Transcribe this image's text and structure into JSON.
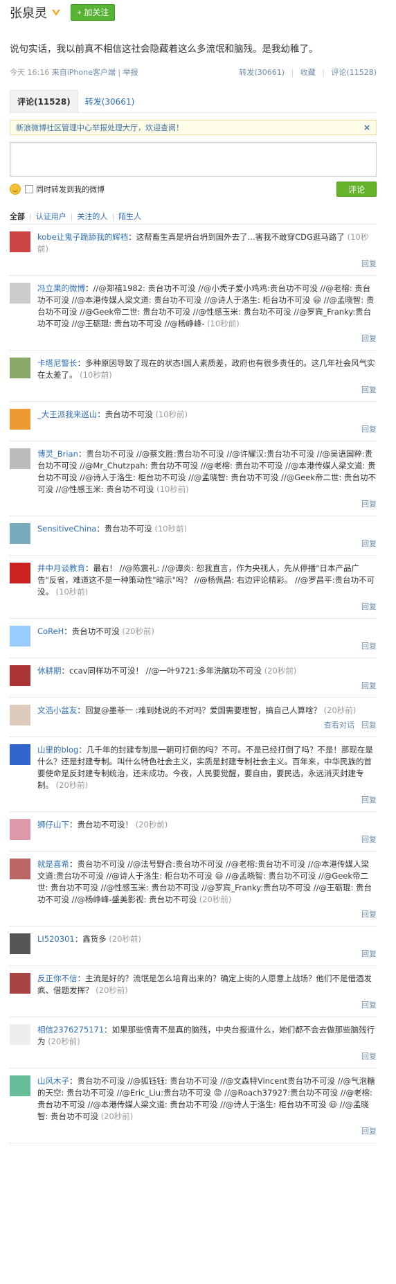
{
  "header": {
    "user_name": "张泉灵",
    "follow_label": "加关注"
  },
  "status": {
    "text": "说句实话，我以前真不相信这社会隐藏着这么多流氓和脑残。是我幼稚了。",
    "time": "今天 16:16",
    "source": "来自iPhone客户端",
    "report": "举报",
    "repost": "转发(30661)",
    "fav": "收藏",
    "comment": "评论(11528)"
  },
  "tabs": [
    {
      "label": "评论(11528)"
    },
    {
      "label": "转发(30661)"
    }
  ],
  "notice": {
    "text": "新浪微博社区管理中心举报处理大厅，欢迎查阅！",
    "close": "×"
  },
  "composer": {
    "checkbox_label": "同时转发到我的微博",
    "submit_label": "评论"
  },
  "filters": [
    {
      "label": "全部"
    },
    {
      "label": "认证用户"
    },
    {
      "label": "关注的人"
    },
    {
      "label": "陌生人"
    }
  ],
  "comments": [
    {
      "author": "kobe让鬼子跪舔我的辉裆",
      "text": "：这帮畜生真是坍台坍到国外去了...害我不敢穿CDG逛马路了",
      "time": "(10秒前)"
    },
    {
      "author": "冯立果的微博",
      "text": "：//@郑禧1982: 贵台功不可没 //@小秃子爱小鸡鸡:贵台功不可没 //@老榕: 贵台功不可没 //@本港传媒人梁文道: 贵台功不可没 //@诗人于洛生: 柜台功不可没 😃 //@孟晓智: 贵台功不可没 //@Geek帝二世: 贵台功不可没 //@性感玉米: 贵台功不可没 //@罗宾_Franky:贵台功不可没 //@王砺琨: 贵台功不可没 //@杨峥峰- ",
      "time": "(10秒前)"
    },
    {
      "author": "卡塔尼警长",
      "text": "：多种原因导致了现在的状态!国人素质差，政府也有很多责任的。这几年社会风气实在太差了。",
      "time": "(10秒前)"
    },
    {
      "author": "_大王派我来巡山",
      "text": "：贵台功不可没",
      "time": "(10秒前)"
    },
    {
      "author": "博灵_Brian",
      "text": "：贵台功不可没 //@蔡文胜:贵台功不可没 //@许耀汉:贵台功不可没 //@吴语国粹:贵台功不可没 //@Mr_Chutzpah: 贵台功不可没 //@老榕: 贵台功不可没 //@本港传媒人梁文道: 贵台功不可没 //@诗人于洛生: 柜台功不可没 //@孟晓智: 贵台功不可没 //@Geek帝二世: 贵台功不可没 //@性感玉米: 贵台功不可没 ",
      "time": "(10秒前)"
    },
    {
      "author": "SensitiveChina",
      "text": "：贵台功不可没",
      "time": "(10秒前)"
    },
    {
      "author": "井中月谈教育",
      "text": "：最右！ //@陈震礼: //@谭炎: 恕我直言，作为央视人，先从停播\"日本产品广告\"反省，难道这不是一种策动性\"暗示\"吗？ //@杨佩昌: 右边评论精彩。 //@罗昌平:贵台功不可没。",
      "time": "(10秒前)"
    },
    {
      "author": "CoReH",
      "text": "：贵台功不可没",
      "time": "(20秒前)"
    },
    {
      "author": "休耕期",
      "text": "：ccav同样功不可没！ //@一叶9721:多年洗脑功不可没",
      "time": "(20秒前)"
    },
    {
      "author": "文浩小盆友",
      "text": "：回复@墨菲一 :难到她说的不对吗？爱国需要理智，搞自己人算啥？",
      "time": "(20秒前)",
      "extra": "查看对话"
    },
    {
      "author": "山里的blog",
      "text": "：几千年的封建专制是一朝可打倒的吗？不可。不是已经打倒了吗？不是！那现在是什么？还是封建专制。叫什么特色社会主义，实质是封建专制社会主义。百年来，中华民族的首要使命是反封建专制统治，还未成功。今夜，人民要觉醒，要自由，要民选，永远消灭封建专制。",
      "time": "(20秒前)"
    },
    {
      "author": "狮仔山下",
      "text": "：贵台功不可没！",
      "time": "(20秒前)"
    },
    {
      "author": "就是喜希",
      "text": "：贵台功不可没 //@法号野合:贵台功不可没 //@老榕:贵台功不可没 //@本港传媒人梁文道:贵台功不可没 //@诗人于洛生: 柜台功不可没 😃 //@孟晓智: 贵台功不可没 //@Geek帝二世: 贵台功不可没 //@性感玉米: 贵台功不可没 //@罗宾_Franky:贵台功不可没 //@王砺琨: 贵台功不可没 //@杨峥峰-盛美影视: 贵台功不可没",
      "time": "(20秒前)"
    },
    {
      "author": "LI520301",
      "text": "：鑫货多",
      "time": "(20秒前)"
    },
    {
      "author": "反正你不信",
      "text": "：主流是好的？流氓是怎么培育出来的？确定上街的人愿意上战场？他们不是借酒发疯、借题发挥？",
      "time": "(20秒前)"
    },
    {
      "author": "相信2376275171",
      "text": "：如果那些愤青不是真的脑残，中央台报道什么，她们都不会去做那些脑残行为",
      "time": "(20秒前)"
    },
    {
      "author": "山风木子",
      "text": "：贵台功不可没 //@狐钰钰: 贵台功不可没 //@文森特Vincent贵台功不可没 //@气泡糖的天空: 贵台功不可没 //@Eric_Liu:贵台功不可没 😡 //@Roach37927:贵台功不可没 //@老榕: 贵台功不可没 //@本港传媒人梁文道: 贵台功不可没 //@诗人于洛生: 柜台功不可没 😃 //@孟晓智: 贵台功不可没",
      "time": "(20秒前)"
    }
  ],
  "reply_label": "回复",
  "colors": {
    "link": "#2e6fb7",
    "follow_green": "#56b334",
    "submit_green": "#66b42c",
    "notice_bg": "#fefee8",
    "meta_gray": "#999999"
  }
}
